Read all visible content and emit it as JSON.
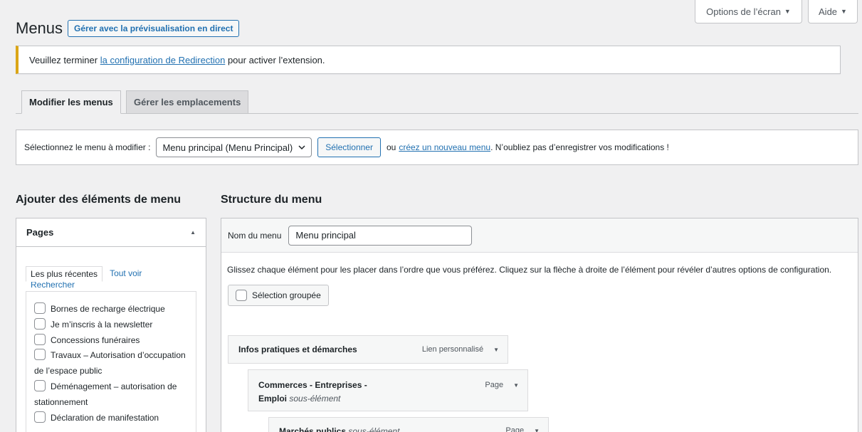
{
  "header": {
    "screen_options": "Options de l’écran",
    "help": "Aide",
    "caret_icon": "▼",
    "title": "Menus",
    "live_preview_button": "Gérer avec la prévisualisation en direct"
  },
  "notice": {
    "before": "Veuillez terminer ",
    "link": "la configuration de Redirection",
    "after": " pour activer l’extension."
  },
  "tabs": [
    {
      "label": "Modifier les menus",
      "active": true
    },
    {
      "label": "Gérer les emplacements",
      "active": false
    }
  ],
  "menu_select": {
    "label": "Sélectionnez le menu à modifier :",
    "selected": "Menu principal (Menu Principal)",
    "button": "Sélectionner",
    "or_text": "ou",
    "create_link": "créez un nouveau menu",
    "reminder": ". N’oubliez pas d’enregistrer vos modifications !"
  },
  "add_items": {
    "heading": "Ajouter des éléments de menu",
    "pages_panel_title": "Pages",
    "collapse_icon": "▲",
    "subtabs": [
      "Les plus récentes",
      "Tout voir",
      "Rechercher"
    ],
    "pages": [
      "Bornes de recharge électrique",
      "Je m’inscris à la newsletter",
      "Concessions funéraires",
      "Travaux – Autorisation d’occupation de l’espace public",
      "Déménagement – autorisation de stationnement",
      "Déclaration de manifestation"
    ]
  },
  "structure": {
    "heading": "Structure du menu",
    "name_label": "Nom du menu",
    "name_value": "Menu principal",
    "instructions": "Glissez chaque élément pour les placer dans l’ordre que vous préférez. Cliquez sur la flèche à droite de l’élément pour révéler d’autres options de configuration.",
    "bulk_select": "Sélection groupée",
    "items": [
      {
        "title": "Infos pratiques et démarches",
        "sub": "",
        "type": "Lien personnalisé"
      },
      {
        "title": "Commerces - Entreprises - Emploi",
        "sub": "sous-élément",
        "type": "Page"
      },
      {
        "title": "Marchés publics",
        "sub": "sous-élément",
        "type": "Page"
      }
    ]
  }
}
